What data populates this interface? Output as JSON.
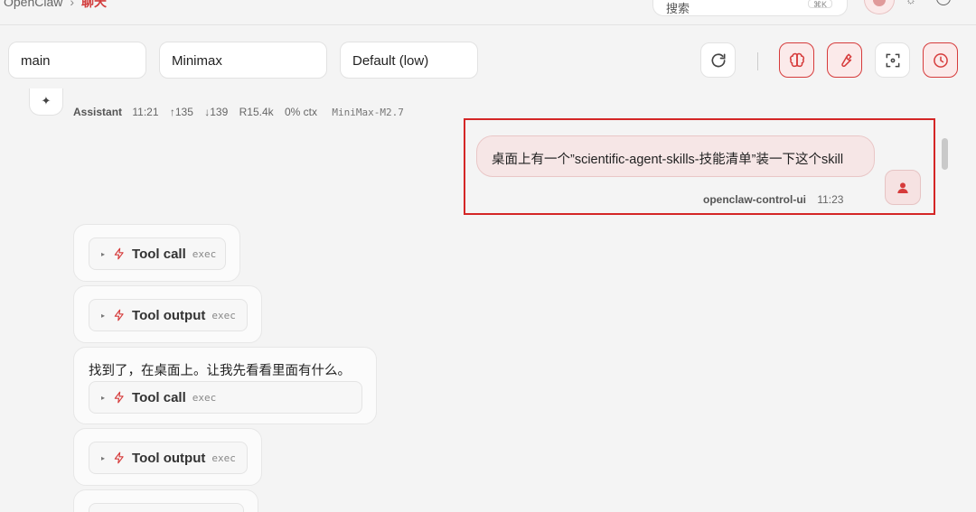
{
  "breadcrumb": {
    "root": "OpenClaw",
    "separator": "›",
    "current": "聊天"
  },
  "search": {
    "placeholder": "搜索",
    "shortcut": "⌘K"
  },
  "selectors": {
    "session": "main",
    "model": "Minimax",
    "thinking": "Default (low)"
  },
  "toolbar": {
    "refresh_icon": "refresh-icon",
    "brain_icon": "brain-icon",
    "wrench_icon": "wrench-icon",
    "focus_icon": "focus-icon",
    "clock_icon": "clock-icon",
    "accent": "#d63b3b"
  },
  "assistant_meta": {
    "role": "Assistant",
    "time": "11:21",
    "tokens_in": "↑135",
    "tokens_out": "↓139",
    "cache": "R15.4k",
    "ctx": "0% ctx",
    "model": "MiniMax-M2.7"
  },
  "user_message": {
    "text": "桌面上有一个”scientific-agent-skills-技能清单”装一下这个skill",
    "sender": "openclaw-control-ui",
    "time": "11:23"
  },
  "messages": [
    {
      "label": "Tool call",
      "tag": "exec"
    },
    {
      "label": "Tool output",
      "tag": "exec"
    },
    {
      "text": "找到了，在桌面上。让我先看看里面有什么。",
      "label": "Tool call",
      "tag": "exec"
    },
    {
      "label": "Tool output",
      "tag": "exec"
    }
  ]
}
